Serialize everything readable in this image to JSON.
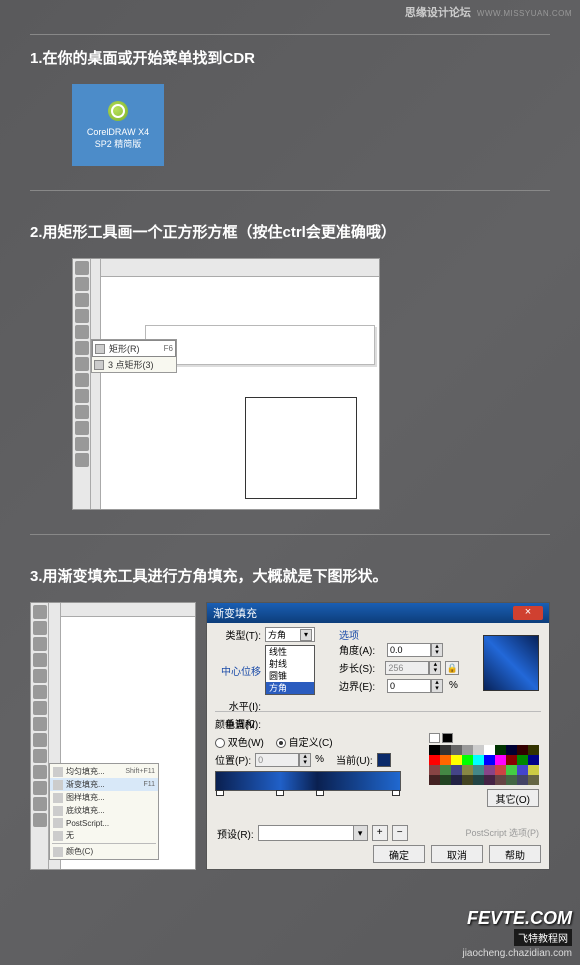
{
  "watermark": {
    "top_zh": "思缘设计论坛",
    "top_en": "WWW.MISSYUAN.COM",
    "btm_main": "FEVTE",
    "btm_com": ".COM",
    "btm_tag": "飞特教程网",
    "btm_url": "jiaocheng.chazidian.com"
  },
  "step1": {
    "title": "1.在你的桌面或开始菜单找到CDR",
    "icon_line1": "CorelDRAW X4",
    "icon_line2": "SP2 精简版"
  },
  "step2": {
    "title": "2.用矩形工具画一个正方形方框（按住ctrl会更准确哦）",
    "flyout": {
      "r1": "矩形(R)",
      "r1k": "F6",
      "r2": "3 点矩形(3)"
    }
  },
  "step3": {
    "title": "3.用渐变填充工具进行方角填充，大概就是下图形状。",
    "flyout": {
      "r1": "均匀填充...",
      "r1k": "Shift+F11",
      "r2": "渐变填充...",
      "r2k": "F11",
      "r3": "图样填充...",
      "r4": "底纹填充...",
      "r5": "PostScript...",
      "r6": "无",
      "r7": "颜色(C)"
    }
  },
  "dlg": {
    "title": "渐变填充",
    "type_lbl": "类型(T):",
    "type_val": "方角",
    "type_opts": [
      "线性",
      "射线",
      "圆锥",
      "方角"
    ],
    "center_lbl": "中心位移",
    "horz_lbl": "水平(I):",
    "vert_lbl": "垂直(V):",
    "options_lbl": "选项",
    "angle_lbl": "角度(A):",
    "angle_val": "0.0",
    "steps_lbl": "步长(S):",
    "steps_val": "256",
    "edge_lbl": "边界(E):",
    "edge_val": "0",
    "pct": "%",
    "blend_lbl": "颜色调和",
    "two_lbl": "双色(W)",
    "custom_lbl": "自定义(C)",
    "pos_lbl": "位置(P):",
    "pos_val": "0",
    "cur_lbl": "当前(U):",
    "other_btn": "其它(O)",
    "preset_lbl": "预设(R):",
    "ps_lbl": "PostScript 选项(P)",
    "ok": "确定",
    "cancel": "取消",
    "help": "帮助"
  }
}
